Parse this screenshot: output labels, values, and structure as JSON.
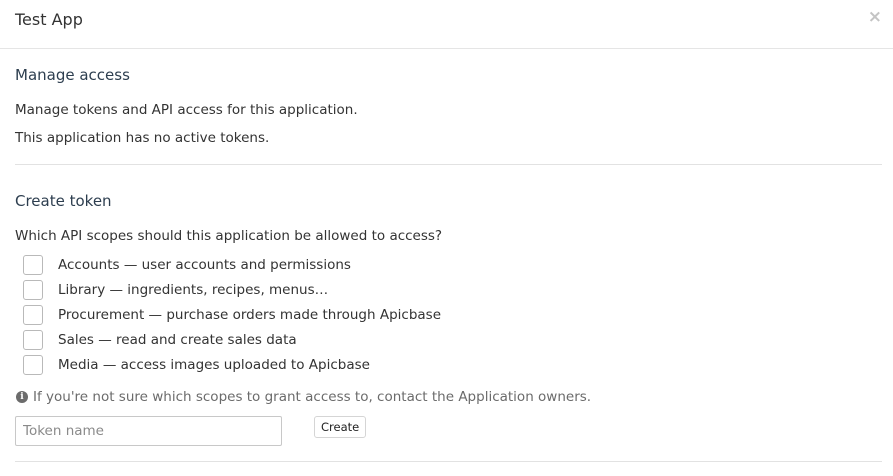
{
  "header": {
    "title": "Test App",
    "close_glyph": "×"
  },
  "manage": {
    "heading": "Manage access",
    "description": "Manage tokens and API access for this application.",
    "status": "This application has no active tokens."
  },
  "create": {
    "heading": "Create token",
    "question": "Which API scopes should this application be allowed to access?",
    "scopes": [
      {
        "label": "Accounts — user accounts and permissions",
        "checked": false
      },
      {
        "label": "Library — ingredients, recipes, menus…",
        "checked": false
      },
      {
        "label": "Procurement — purchase orders made through Apicbase",
        "checked": false
      },
      {
        "label": "Sales — read and create sales data",
        "checked": false
      },
      {
        "label": "Media — access images uploaded to Apicbase",
        "checked": false
      }
    ],
    "hint": "If you're not sure which scopes to grant access to, contact the Application owners.",
    "hint_icon": "info-circle-icon",
    "token_placeholder": "Token name",
    "token_value": "",
    "button_label": "Create"
  }
}
